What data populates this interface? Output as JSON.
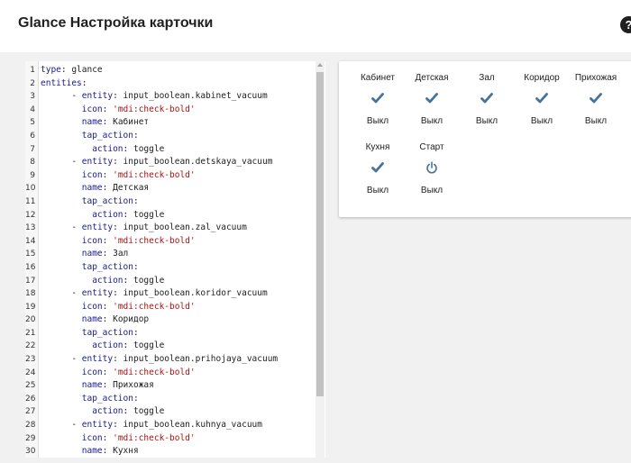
{
  "dialog": {
    "title": "Glance Настройка карточки",
    "help_icon": "help-icon",
    "help_glyph": "?"
  },
  "editor": {
    "lines": [
      {
        "n": "1",
        "indent": "",
        "parts": [
          [
            "k",
            "type"
          ],
          [
            "p",
            ": glance"
          ]
        ]
      },
      {
        "n": "2",
        "indent": "",
        "parts": [
          [
            "k",
            "entities"
          ],
          [
            "p",
            ":"
          ]
        ]
      },
      {
        "n": "3",
        "indent": "      ",
        "parts": [
          [
            "p",
            "- "
          ],
          [
            "k",
            "entity"
          ],
          [
            "p",
            ": input_boolean.kabinet_vacuum"
          ]
        ]
      },
      {
        "n": "4",
        "indent": "        ",
        "parts": [
          [
            "k",
            "icon"
          ],
          [
            "p",
            ": "
          ],
          [
            "s",
            "'mdi:check-bold'"
          ]
        ]
      },
      {
        "n": "5",
        "indent": "        ",
        "parts": [
          [
            "k",
            "name"
          ],
          [
            "p",
            ": Кабинет"
          ]
        ]
      },
      {
        "n": "6",
        "indent": "        ",
        "parts": [
          [
            "k",
            "tap_action"
          ],
          [
            "p",
            ":"
          ]
        ]
      },
      {
        "n": "7",
        "indent": "          ",
        "parts": [
          [
            "k",
            "action"
          ],
          [
            "p",
            ": toggle"
          ]
        ]
      },
      {
        "n": "8",
        "indent": "      ",
        "parts": [
          [
            "p",
            "- "
          ],
          [
            "k",
            "entity"
          ],
          [
            "p",
            ": input_boolean.detskaya_vacuum"
          ]
        ]
      },
      {
        "n": "9",
        "indent": "        ",
        "parts": [
          [
            "k",
            "icon"
          ],
          [
            "p",
            ": "
          ],
          [
            "s",
            "'mdi:check-bold'"
          ]
        ]
      },
      {
        "n": "10",
        "indent": "        ",
        "parts": [
          [
            "k",
            "name"
          ],
          [
            "p",
            ": Детская"
          ]
        ]
      },
      {
        "n": "11",
        "indent": "        ",
        "parts": [
          [
            "k",
            "tap_action"
          ],
          [
            "p",
            ":"
          ]
        ]
      },
      {
        "n": "12",
        "indent": "          ",
        "parts": [
          [
            "k",
            "action"
          ],
          [
            "p",
            ": toggle"
          ]
        ]
      },
      {
        "n": "13",
        "indent": "      ",
        "parts": [
          [
            "p",
            "- "
          ],
          [
            "k",
            "entity"
          ],
          [
            "p",
            ": input_boolean.zal_vacuum"
          ]
        ]
      },
      {
        "n": "14",
        "indent": "        ",
        "parts": [
          [
            "k",
            "icon"
          ],
          [
            "p",
            ": "
          ],
          [
            "s",
            "'mdi:check-bold'"
          ]
        ]
      },
      {
        "n": "15",
        "indent": "        ",
        "parts": [
          [
            "k",
            "name"
          ],
          [
            "p",
            ": Зал"
          ]
        ]
      },
      {
        "n": "16",
        "indent": "        ",
        "parts": [
          [
            "k",
            "tap_action"
          ],
          [
            "p",
            ":"
          ]
        ]
      },
      {
        "n": "17",
        "indent": "          ",
        "parts": [
          [
            "k",
            "action"
          ],
          [
            "p",
            ": toggle"
          ]
        ]
      },
      {
        "n": "18",
        "indent": "      ",
        "parts": [
          [
            "p",
            "- "
          ],
          [
            "k",
            "entity"
          ],
          [
            "p",
            ": input_boolean.koridor_vacuum"
          ]
        ]
      },
      {
        "n": "19",
        "indent": "        ",
        "parts": [
          [
            "k",
            "icon"
          ],
          [
            "p",
            ": "
          ],
          [
            "s",
            "'mdi:check-bold'"
          ]
        ]
      },
      {
        "n": "20",
        "indent": "        ",
        "parts": [
          [
            "k",
            "name"
          ],
          [
            "p",
            ": Коридор"
          ]
        ]
      },
      {
        "n": "21",
        "indent": "        ",
        "parts": [
          [
            "k",
            "tap_action"
          ],
          [
            "p",
            ":"
          ]
        ]
      },
      {
        "n": "22",
        "indent": "          ",
        "parts": [
          [
            "k",
            "action"
          ],
          [
            "p",
            ": toggle"
          ]
        ]
      },
      {
        "n": "23",
        "indent": "      ",
        "parts": [
          [
            "p",
            "- "
          ],
          [
            "k",
            "entity"
          ],
          [
            "p",
            ": input_boolean.prihojaya_vacuum"
          ]
        ]
      },
      {
        "n": "24",
        "indent": "        ",
        "parts": [
          [
            "k",
            "icon"
          ],
          [
            "p",
            ": "
          ],
          [
            "s",
            "'mdi:check-bold'"
          ]
        ]
      },
      {
        "n": "25",
        "indent": "        ",
        "parts": [
          [
            "k",
            "name"
          ],
          [
            "p",
            ": Прихожая"
          ]
        ]
      },
      {
        "n": "26",
        "indent": "        ",
        "parts": [
          [
            "k",
            "tap_action"
          ],
          [
            "p",
            ":"
          ]
        ]
      },
      {
        "n": "27",
        "indent": "          ",
        "parts": [
          [
            "k",
            "action"
          ],
          [
            "p",
            ": toggle"
          ]
        ]
      },
      {
        "n": "28",
        "indent": "      ",
        "parts": [
          [
            "p",
            "- "
          ],
          [
            "k",
            "entity"
          ],
          [
            "p",
            ": input_boolean.kuhnya_vacuum"
          ]
        ]
      },
      {
        "n": "29",
        "indent": "        ",
        "parts": [
          [
            "k",
            "icon"
          ],
          [
            "p",
            ": "
          ],
          [
            "s",
            "'mdi:check-bold'"
          ]
        ]
      },
      {
        "n": "30",
        "indent": "        ",
        "parts": [
          [
            "k",
            "name"
          ],
          [
            "p",
            ": Кухня"
          ]
        ]
      }
    ]
  },
  "card": {
    "entities": [
      {
        "name": "Кабинет",
        "icon": "check-bold-icon",
        "state": "Выкл"
      },
      {
        "name": "Детская",
        "icon": "check-bold-icon",
        "state": "Выкл"
      },
      {
        "name": "Зал",
        "icon": "check-bold-icon",
        "state": "Выкл"
      },
      {
        "name": "Коридор",
        "icon": "check-bold-icon",
        "state": "Выкл"
      },
      {
        "name": "Прихожая",
        "icon": "check-bold-icon",
        "state": "Выкл"
      },
      {
        "name": "Кухня",
        "icon": "check-bold-icon",
        "state": "Выкл"
      },
      {
        "name": "Старт",
        "icon": "power-icon",
        "state": "Выкл"
      }
    ]
  },
  "colors": {
    "icon_color": "#44739e",
    "yaml_key": "#1a1a8c",
    "yaml_string": "#aa1111"
  }
}
